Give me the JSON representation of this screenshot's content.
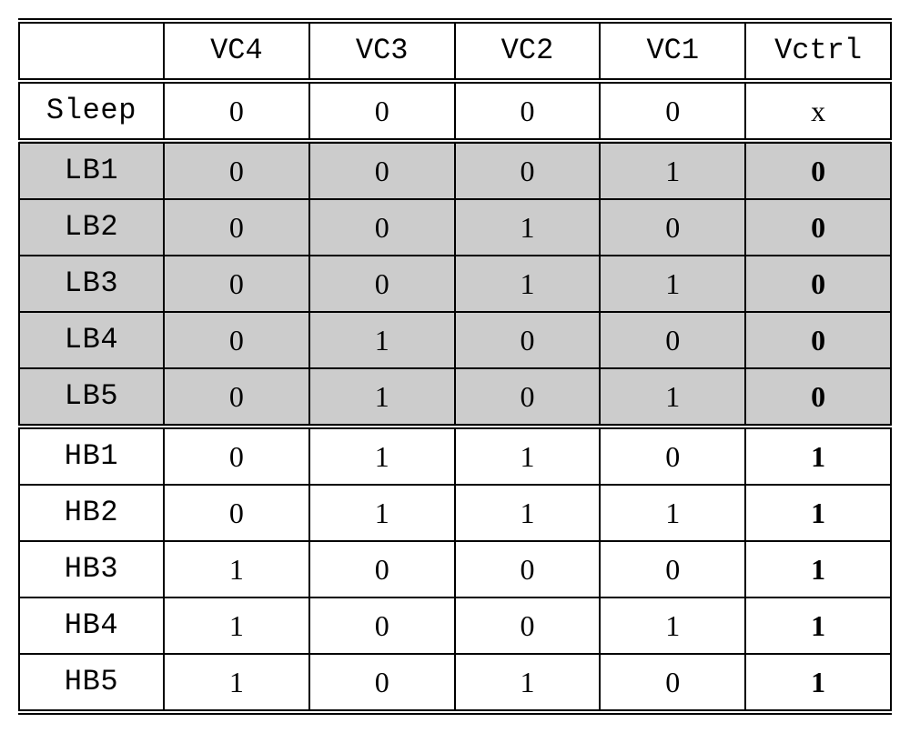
{
  "chart_data": {
    "type": "table",
    "headers": [
      "",
      "VC4",
      "VC3",
      "VC2",
      "VC1",
      "Vctrl"
    ],
    "rows": [
      {
        "label": "Sleep",
        "cells": [
          "0",
          "0",
          "0",
          "0",
          "x"
        ],
        "shaded": false,
        "boldLast": false,
        "section": "sleep"
      },
      {
        "label": "LB1",
        "cells": [
          "0",
          "0",
          "0",
          "1",
          "0"
        ],
        "shaded": true,
        "boldLast": true,
        "section": "lb"
      },
      {
        "label": "LB2",
        "cells": [
          "0",
          "0",
          "1",
          "0",
          "0"
        ],
        "shaded": true,
        "boldLast": true,
        "section": "lb"
      },
      {
        "label": "LB3",
        "cells": [
          "0",
          "0",
          "1",
          "1",
          "0"
        ],
        "shaded": true,
        "boldLast": true,
        "section": "lb"
      },
      {
        "label": "LB4",
        "cells": [
          "0",
          "1",
          "0",
          "0",
          "0"
        ],
        "shaded": true,
        "boldLast": true,
        "section": "lb"
      },
      {
        "label": "LB5",
        "cells": [
          "0",
          "1",
          "0",
          "1",
          "0"
        ],
        "shaded": true,
        "boldLast": true,
        "section": "lb"
      },
      {
        "label": "HB1",
        "cells": [
          "0",
          "1",
          "1",
          "0",
          "1"
        ],
        "shaded": false,
        "boldLast": true,
        "section": "hb"
      },
      {
        "label": "HB2",
        "cells": [
          "0",
          "1",
          "1",
          "1",
          "1"
        ],
        "shaded": false,
        "boldLast": true,
        "section": "hb"
      },
      {
        "label": "HB3",
        "cells": [
          "1",
          "0",
          "0",
          "0",
          "1"
        ],
        "shaded": false,
        "boldLast": true,
        "section": "hb"
      },
      {
        "label": "HB4",
        "cells": [
          "1",
          "0",
          "0",
          "1",
          "1"
        ],
        "shaded": false,
        "boldLast": true,
        "section": "hb"
      },
      {
        "label": "HB5",
        "cells": [
          "1",
          "0",
          "1",
          "0",
          "1"
        ],
        "shaded": false,
        "boldLast": true,
        "section": "hb"
      }
    ]
  }
}
